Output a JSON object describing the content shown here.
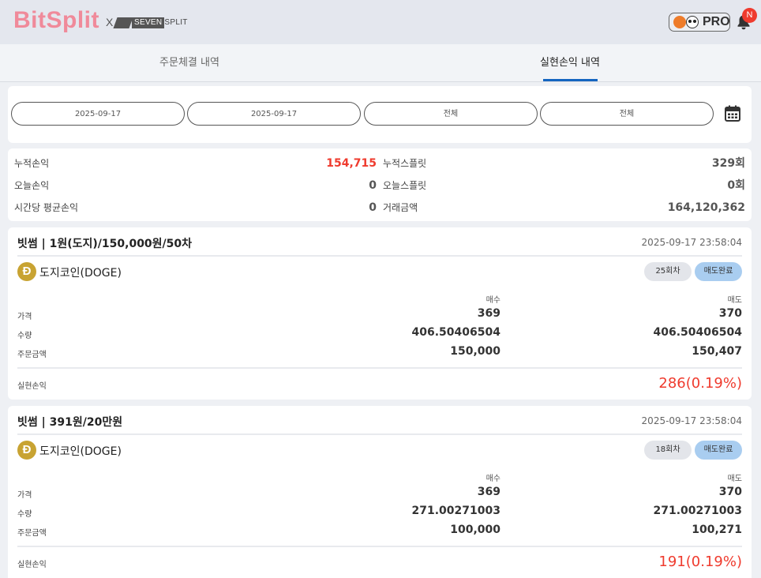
{
  "header": {
    "logo": "BitSplit",
    "logo_x": "X",
    "partner": "SEVENSPLIT",
    "partner_a": "SEVEN",
    "partner_b": "SPLIT",
    "pro_label": "PRO",
    "notification_initial": "N"
  },
  "tabs": [
    {
      "label": "주문체결 내역",
      "active": false
    },
    {
      "label": "실현손익 내역",
      "active": true
    }
  ],
  "filters": {
    "start_date": "2025-09-17",
    "end_date": "2025-09-17",
    "filter_1": "전체",
    "filter_2": "전체"
  },
  "summary": {
    "cumulative_pnl_label": "누적손익",
    "cumulative_pnl_value": "154,715",
    "cumulative_split_label": "누적스플릿",
    "cumulative_split_value": "329회",
    "today_pnl_label": "오늘손익",
    "today_pnl_value": "0",
    "today_split_label": "오늘스플릿",
    "today_split_value": "0회",
    "hourly_avg_label": "시간당 평균손익",
    "hourly_avg_value": "0",
    "volume_label": "거래금액",
    "volume_value": "164,120,362"
  },
  "cards": [
    {
      "title": "빗썸 | 1원(도지)/150,000원/50차",
      "datetime": "2025-09-17 23:58:04",
      "coin_symbol": "Ð",
      "coin_name": "도지코인(DOGE)",
      "round": "25회차",
      "status": "매도완료",
      "buy_header": "매수",
      "sell_header": "매도",
      "price_label": "가격",
      "buy_price": "369",
      "sell_price": "370",
      "qty_label": "수량",
      "buy_qty": "406.50406504",
      "sell_qty": "406.50406504",
      "amount_label": "주문금액",
      "buy_amount": "150,000",
      "sell_amount": "150,407",
      "pnl_label": "실현손익",
      "pnl_value": "286(0.19%)"
    },
    {
      "title": "빗썸 | 391원/20만원",
      "datetime": "2025-09-17 23:58:04",
      "coin_symbol": "Ð",
      "coin_name": "도지코인(DOGE)",
      "round": "18회차",
      "status": "매도완료",
      "buy_header": "매수",
      "sell_header": "매도",
      "price_label": "가격",
      "buy_price": "369",
      "sell_price": "370",
      "qty_label": "수량",
      "buy_qty": "271.00271003",
      "sell_qty": "271.00271003",
      "amount_label": "주문금액",
      "buy_amount": "100,000",
      "sell_amount": "100,271",
      "pnl_label": "실현손익",
      "pnl_value": "191(0.19%)"
    }
  ],
  "colors": {
    "logo": "#f08a9a",
    "accent_blue": "#1565c0",
    "profit_red": "#ef3b2e",
    "status_badge": "#a9cdf0"
  },
  "icons": [
    "bell-icon",
    "calendar-icon",
    "doge-coin-icon"
  ]
}
